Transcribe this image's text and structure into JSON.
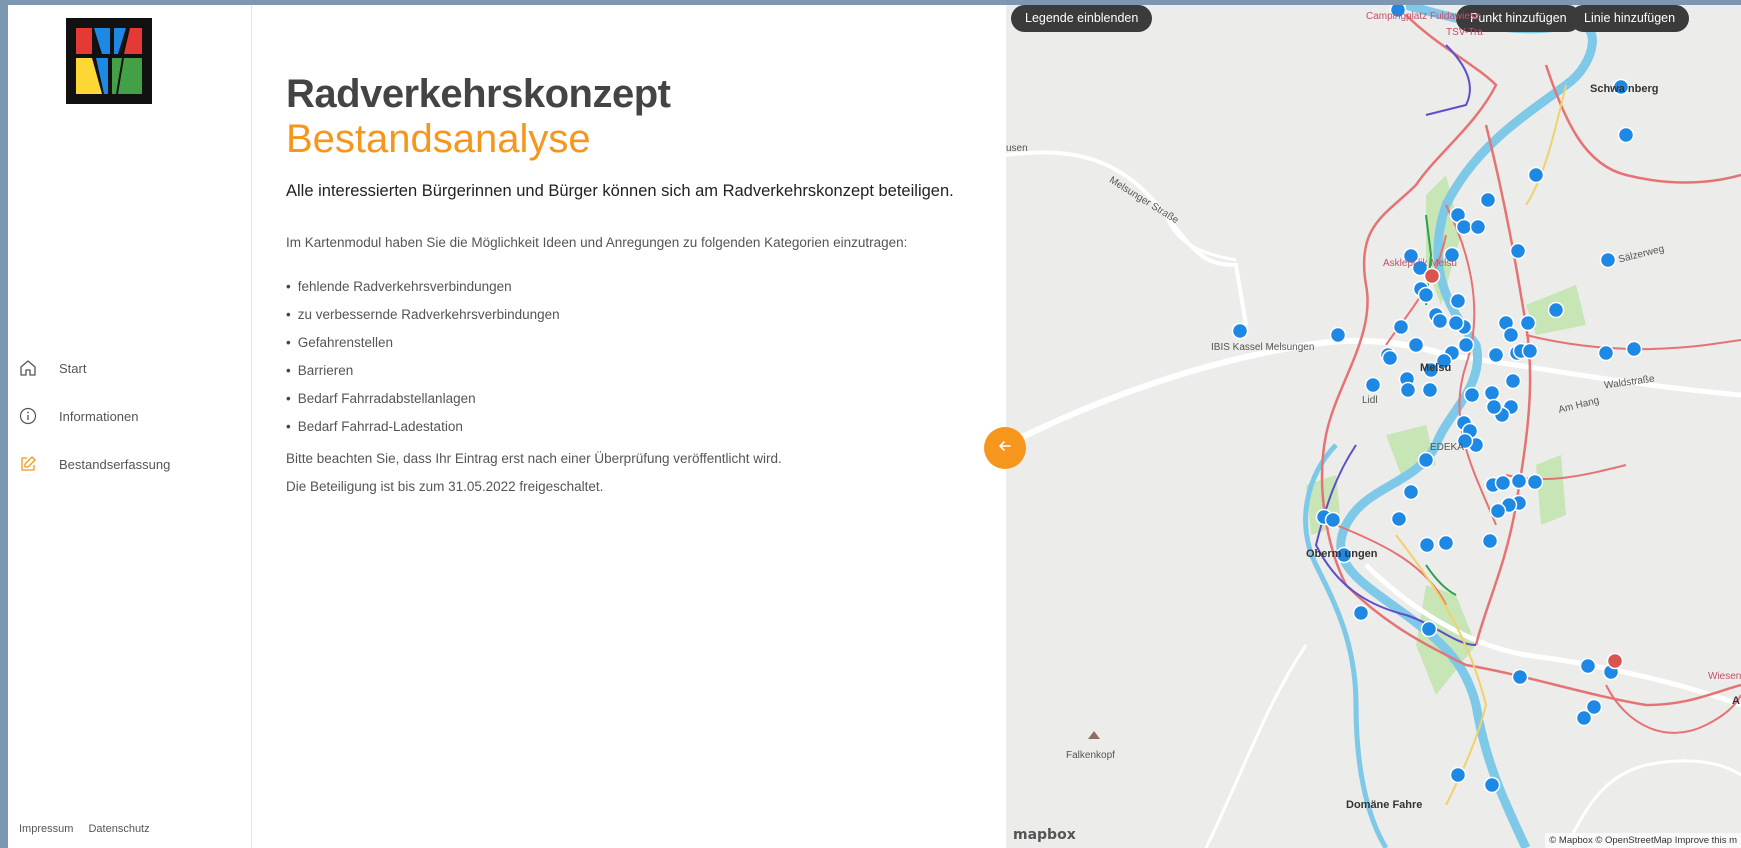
{
  "sidebar": {
    "nav": [
      {
        "label": "Start",
        "icon": "home-icon"
      },
      {
        "label": "Informationen",
        "icon": "info-icon"
      },
      {
        "label": "Bestandserfassung",
        "icon": "edit-icon",
        "active": true
      }
    ],
    "footer": {
      "impressum": "Impressum",
      "datenschutz": "Datenschutz"
    }
  },
  "main": {
    "title": "Radverkehrskonzept",
    "subtitle": "Bestandsanalyse",
    "lead": "Alle interessierten Bürgerinnen und Bürger können sich am Radverkehrskonzept beteiligen.",
    "intro": "Im Kartenmodul haben Sie die Möglichkeit Ideen und Anregungen zu folgenden Kategorien einzutragen:",
    "categories": [
      "fehlende Radverkehrsverbindungen",
      "zu verbessernde Radverkehrsverbindungen",
      "Gefahrenstellen",
      "Barrieren",
      "Bedarf Fahrradabstellanlagen",
      "Bedarf Fahrrad-Ladestation"
    ],
    "note1": "Bitte beachten Sie, dass Ihr Eintrag erst nach einer Überprüfung veröffentlicht wird.",
    "note2": "Die Beteiligung ist bis zum 31.05.2022 freigeschaltet."
  },
  "map": {
    "buttons": {
      "legend": "Legende einblenden",
      "add_point": "Punkt hinzufügen",
      "add_line": "Linie hinzufügen"
    },
    "labels": {
      "camping": "Campingplatz Fuldawiese",
      "tsv": "TSV-Tra",
      "schwarzenberg": "Schwa    nberg",
      "usen": "usen",
      "melsunger_strasse": "Melsunger Straße",
      "salzerweg": "Sälzerweg",
      "asklepios": "Asklepi     lik Melsu",
      "ibis": "IBIS Kassel Melsungen",
      "melsungen": "Melsu",
      "lidl": "Lidl",
      "edeka": "EDEKA",
      "waldstrasse": "Waldstraße",
      "am_hang": "Am Hang",
      "obermelsungen": "Oberm      ungen",
      "falkenkopf": "Falkenkopf",
      "domaene": "Domäne Fahre",
      "wiesen": "Wiesen",
      "a": "A"
    },
    "mapbox_logo": "mapbox",
    "attribution": "© Mapbox © OpenStreetMap  Improve this m",
    "colors": {
      "point": "#1e88e5",
      "point_alt": "#d9534f",
      "river": "#7ec8e8",
      "route": "#e57373",
      "route_alt": "#5c4fc9",
      "green": "#c8e6b5"
    }
  },
  "colors": {
    "accent": "#f7961d",
    "title": "#444444"
  }
}
